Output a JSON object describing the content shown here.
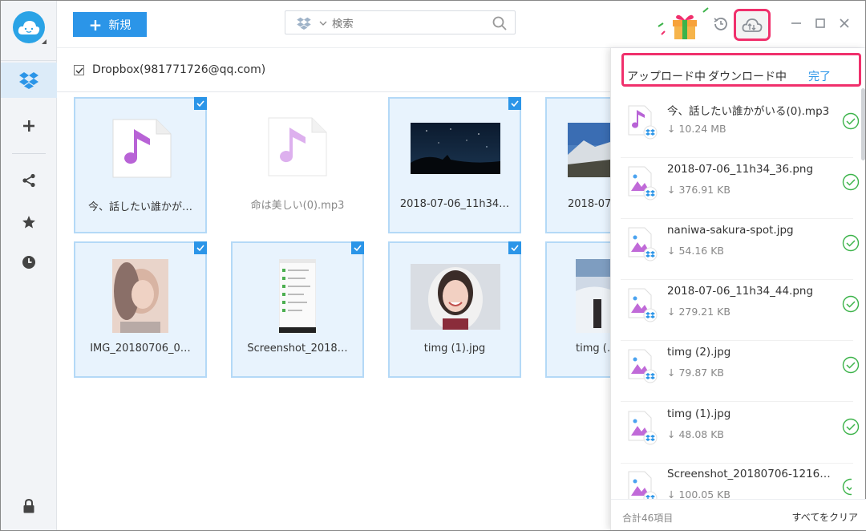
{
  "topbar": {
    "new_label": "新規",
    "search_placeholder": "検索"
  },
  "account": {
    "label": "Dropbox(981771726@qq.com)",
    "checked": true
  },
  "grid": [
    {
      "name": "今、話したい誰かが…",
      "kind": "audio",
      "selected": true
    },
    {
      "name": "命は美しい(0).mp3",
      "kind": "audio-faded",
      "selected": false
    },
    {
      "name": "2018-07-06_11h34…",
      "kind": "night-sky",
      "selected": true
    },
    {
      "name": "2018-07-0…",
      "kind": "landscape",
      "selected": true
    },
    {
      "name": "IMG_20180706_0…",
      "kind": "blurred-portrait",
      "selected": true
    },
    {
      "name": "Screenshot_2018…",
      "kind": "screenshot",
      "selected": true
    },
    {
      "name": "timg (1).jpg",
      "kind": "portrait-snow",
      "selected": true
    },
    {
      "name": "timg (…",
      "kind": "snow-scene",
      "selected": true
    }
  ],
  "panel": {
    "tab_upload": "アップロード中",
    "tab_download": "ダウンロード中",
    "tab_done": "完了",
    "items": [
      {
        "name": "今、話したい誰かがいる(0).mp3",
        "size": "↓ 10.24 MB",
        "type": "audio"
      },
      {
        "name": "2018-07-06_11h34_36.png",
        "size": "↓ 376.91 KB",
        "type": "image"
      },
      {
        "name": "naniwa-sakura-spot.jpg",
        "size": "↓ 54.16 KB",
        "type": "image"
      },
      {
        "name": "2018-07-06_11h34_44.png",
        "size": "↓ 279.21 KB",
        "type": "image"
      },
      {
        "name": "timg (2).jpg",
        "size": "↓ 79.87 KB",
        "type": "image"
      },
      {
        "name": "timg (1).jpg",
        "size": "↓ 48.08 KB",
        "type": "image"
      },
      {
        "name": "Screenshot_20180706-12164…",
        "size": "↓ 100.05 KB",
        "type": "image"
      }
    ],
    "footer_count": "合計46項目",
    "footer_clear": "すべてをクリア"
  },
  "colors": {
    "accent": "#2b95e8",
    "highlight": "#f0306c",
    "success": "#3cb34a",
    "music": "#b863d6"
  }
}
